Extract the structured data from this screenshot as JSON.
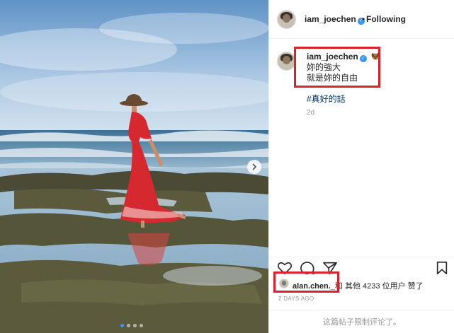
{
  "header": {
    "username": "iam_joechen",
    "separator": "•",
    "follow_status": "Following"
  },
  "caption": {
    "username": "iam_joechen",
    "line1": "妳的強大",
    "line2": "就是妳的自由",
    "hashtag": "#真好的話",
    "age": "2d"
  },
  "likes": {
    "liker": "alan.chen._",
    "rest_prefix": "和 其他 ",
    "count": "4233",
    "rest_suffix": " 位用户 赞了"
  },
  "post": {
    "timestamp": "2 DAYS AGO",
    "comments_limited": "这篇帖子限制评论了。"
  },
  "carousel": {
    "slide_count": 4,
    "active_index": 0
  },
  "icons": {
    "verified": "verified-badge-icon",
    "heart": "heart-icon",
    "comment": "comment-icon",
    "share": "share-icon",
    "save": "bookmark-icon",
    "next": "chevron-right-icon",
    "emoji": "dog-emoji-icon"
  },
  "colors": {
    "verified_blue": "#3897f0",
    "highlight_red": "#d8232a",
    "hashtag": "#003569",
    "muted": "#999999"
  }
}
